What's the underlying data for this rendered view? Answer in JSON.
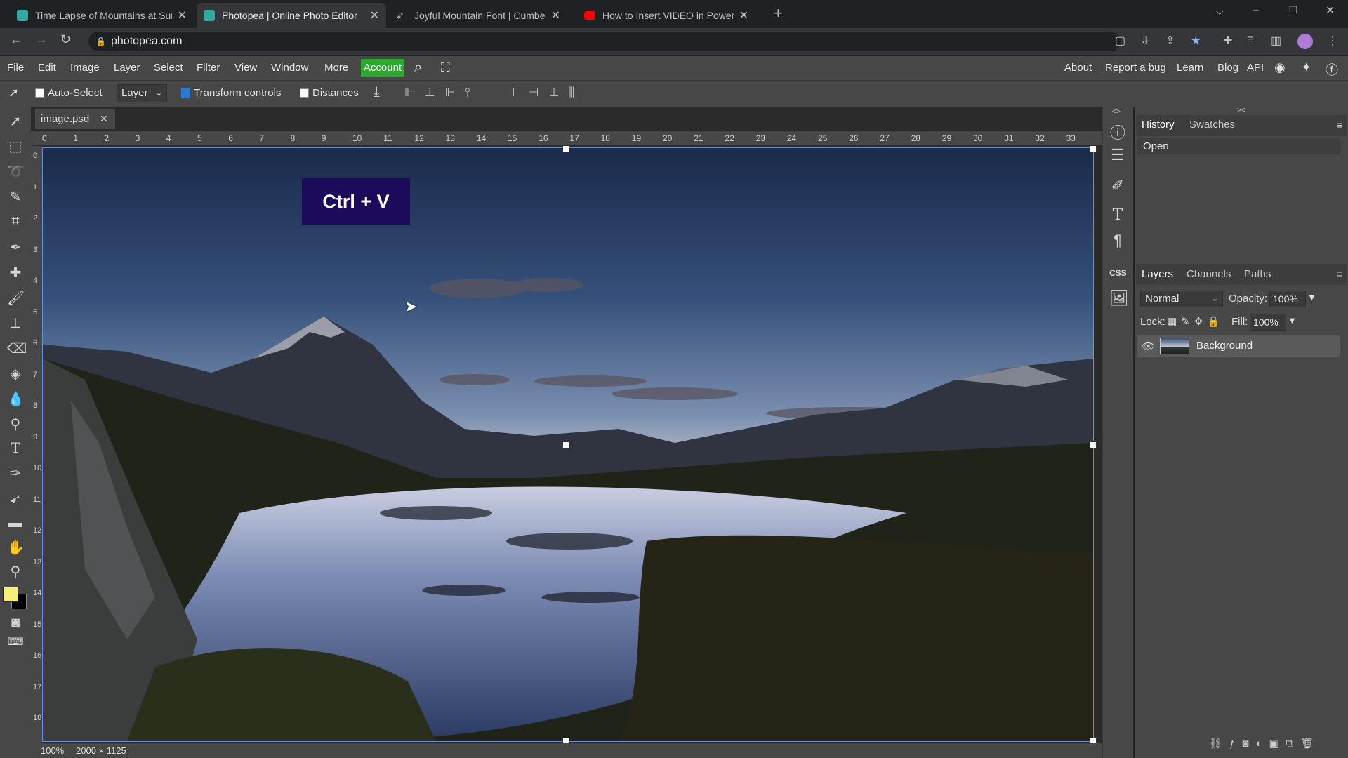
{
  "browser": {
    "tabs": [
      {
        "title": "Time Lapse of Mountains at Sun",
        "icon": "photopea-icon",
        "color": "#31a8a0"
      },
      {
        "title": "Photopea | Online Photo Editor",
        "icon": "photopea-icon",
        "color": "#31a8a0"
      },
      {
        "title": "Joyful Mountain Font | Cumberla",
        "icon": "brush-icon",
        "color": "#bbbbbb"
      },
      {
        "title": "How to Insert VIDEO in PowerPo",
        "icon": "youtube-icon",
        "color": "#ff0000"
      }
    ],
    "url": "photopea.com"
  },
  "menu": {
    "items": [
      "File",
      "Edit",
      "Image",
      "Layer",
      "Select",
      "Filter",
      "View",
      "Window",
      "More"
    ],
    "account": "Account",
    "right": [
      "About",
      "Report a bug",
      "Learn",
      "Blog",
      "API"
    ]
  },
  "options": {
    "auto_select": "Auto-Select",
    "layer_select": "Layer",
    "transform_controls": "Transform controls",
    "distances": "Distances"
  },
  "document": {
    "tab": "image.psd",
    "ruler_top": [
      "0",
      "1",
      "2",
      "3",
      "4",
      "5",
      "6",
      "7",
      "8",
      "9",
      "10",
      "11",
      "12",
      "13",
      "14",
      "15",
      "16",
      "17",
      "18",
      "19",
      "20",
      "21",
      "22",
      "23",
      "24",
      "25",
      "26",
      "27",
      "28",
      "29",
      "30",
      "31",
      "32",
      "33"
    ],
    "ruler_left": [
      "0",
      "1",
      "2",
      "3",
      "4",
      "5",
      "6",
      "7",
      "8",
      "9",
      "10",
      "11",
      "12",
      "13",
      "14",
      "15",
      "16",
      "17",
      "18"
    ],
    "overlay": "Ctrl + V",
    "zoom": "100%",
    "size": "2000 × 1125"
  },
  "history": {
    "tabs": [
      "History",
      "Swatches"
    ],
    "items": [
      "Open"
    ]
  },
  "layers": {
    "tabs": [
      "Layers",
      "Channels",
      "Paths"
    ],
    "blend": "Normal",
    "opacity_label": "Opacity:",
    "opacity": "100%",
    "lock_label": "Lock:",
    "fill_label": "Fill:",
    "fill": "100%",
    "items": [
      {
        "name": "Background"
      }
    ]
  },
  "colors": {
    "foreground": "#f6f07a",
    "background": "#000000",
    "accent": "#2fa82f"
  }
}
